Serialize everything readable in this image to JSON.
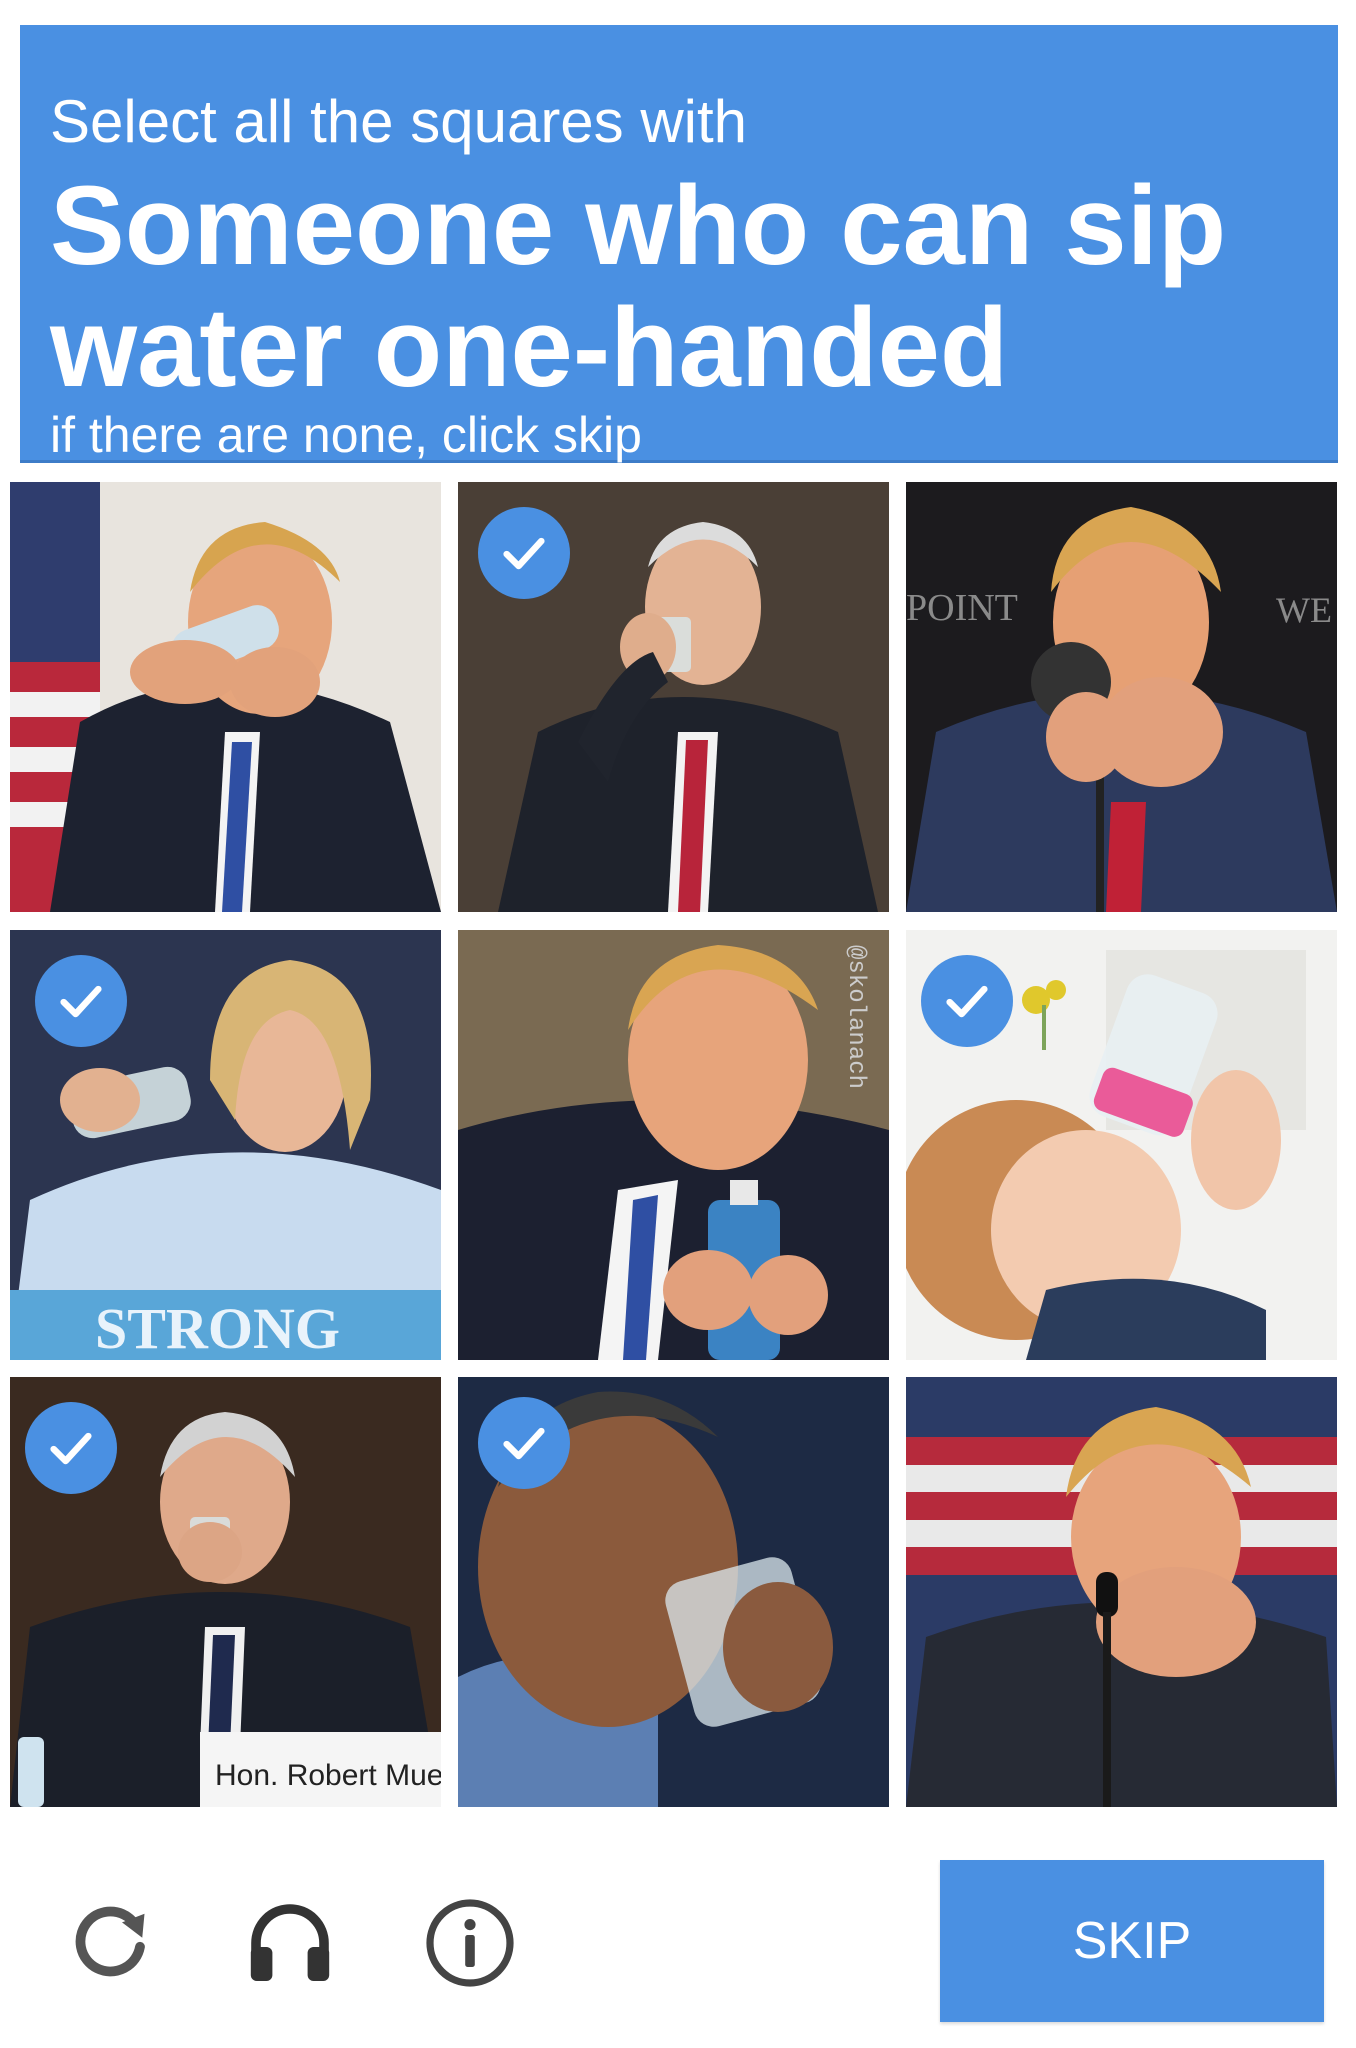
{
  "header": {
    "prompt_line": "Select all the squares with",
    "target": "Someone who can sip water one-handed",
    "hint": "if there are none, click skip"
  },
  "tiles": [
    {
      "subject": "man in suit drinking from plastic water bottle with both hands, US flag behind",
      "selected": false
    },
    {
      "subject": "man in suit sipping from glass with one hand",
      "selected": true
    },
    {
      "subject": "man drinking from glass with both hands behind microphone",
      "selected": false,
      "backdrop_text": "POINT",
      "backdrop_text_2": "WE"
    },
    {
      "subject": "woman sipping from glass with one hand",
      "selected": true,
      "sign_text": "STRONG"
    },
    {
      "subject": "man leaning toward water bottle held with two hands",
      "selected": false,
      "watermark": "@skolanach"
    },
    {
      "subject": "baby drinking from pink bottle",
      "selected": true
    },
    {
      "subject": "man sipping from glass at hearing",
      "selected": true,
      "nameplate": "Hon. Robert Mueller,"
    },
    {
      "subject": "man drinking from glass of water",
      "selected": true
    },
    {
      "subject": "man drinking from glass with both hands, flag behind",
      "selected": false
    }
  ],
  "footer": {
    "reload_icon": "reload-icon",
    "audio_icon": "headphones-icon",
    "info_icon": "info-icon",
    "skip_label": "SKIP"
  },
  "colors": {
    "accent": "#4a90e2",
    "text_on_accent": "#ffffff",
    "icon_gray": "#555555"
  }
}
